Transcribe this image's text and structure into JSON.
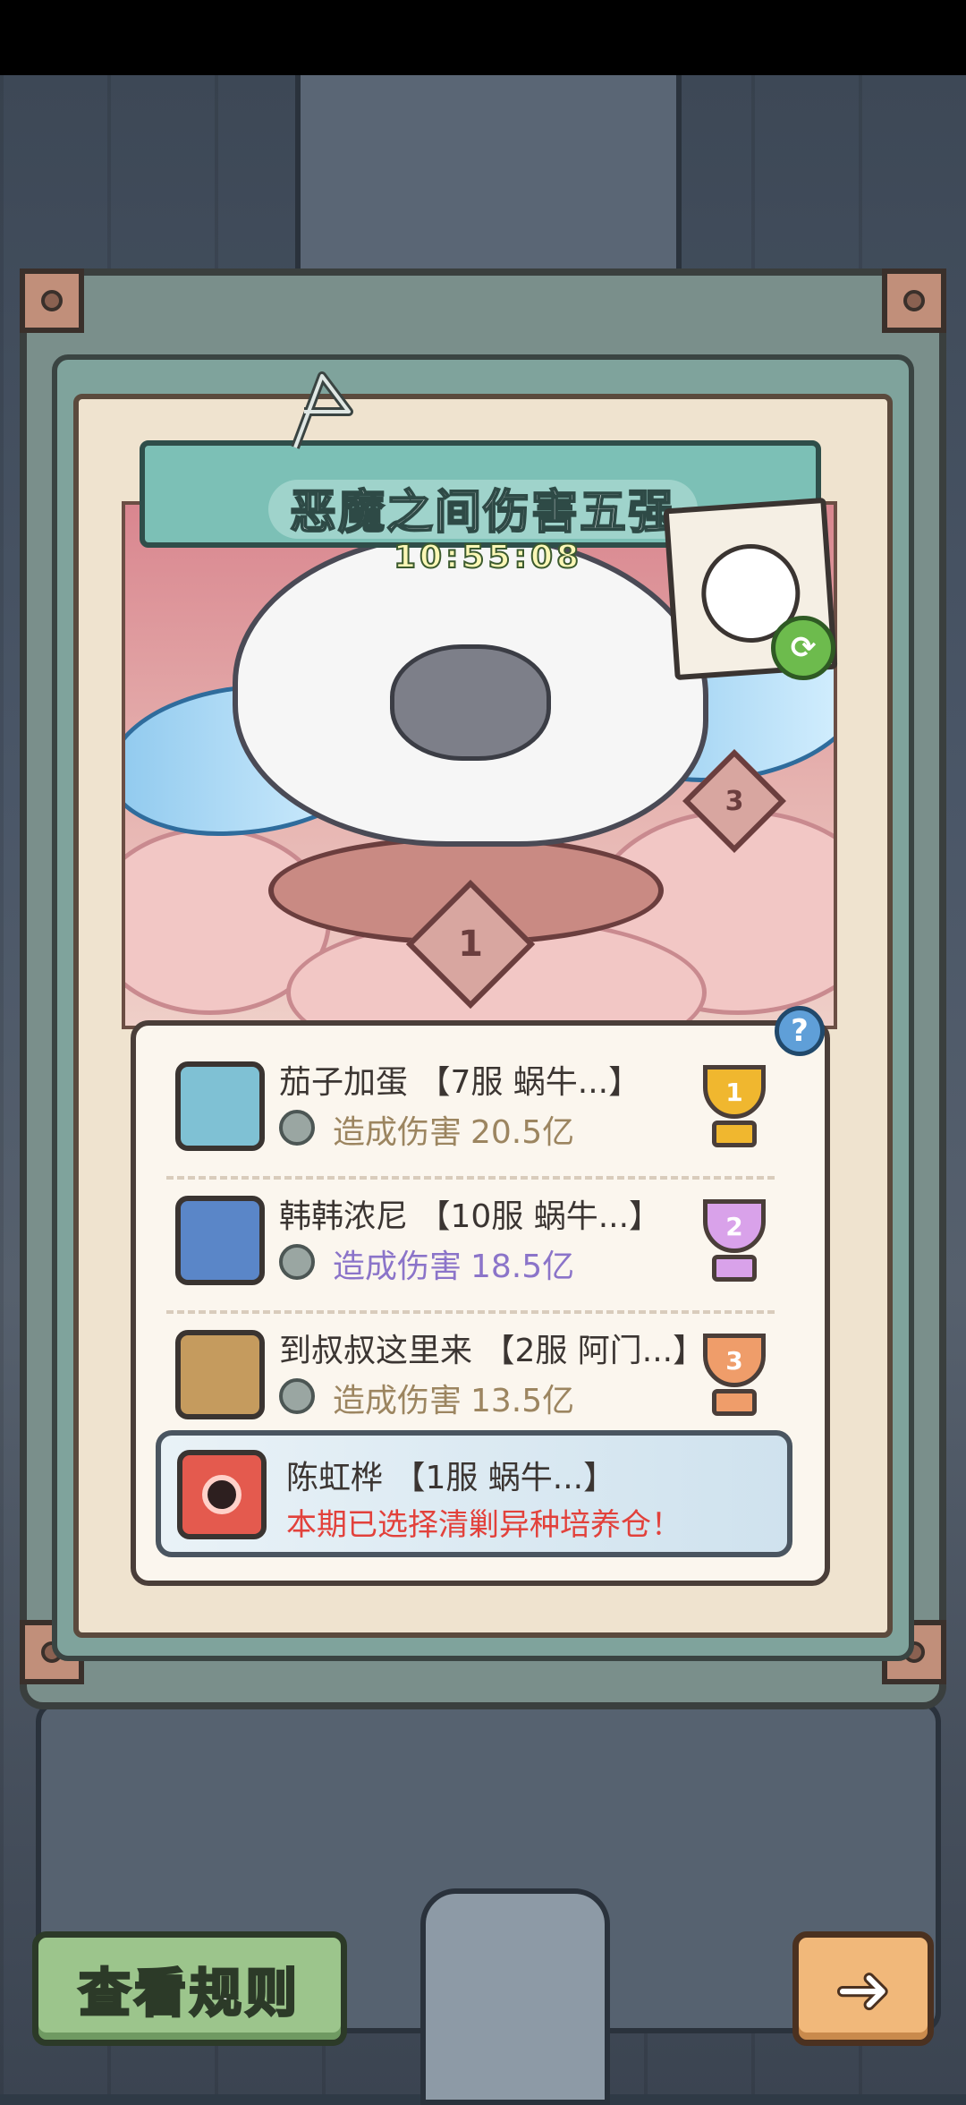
{
  "event": {
    "title": "恶魔之间伤害五强",
    "timer": "10:55:08"
  },
  "art": {
    "rank1_label": "1",
    "rank3_label": "3"
  },
  "ranking": {
    "help_label": "?",
    "rows": [
      {
        "rank": "1",
        "name": "茄子加蛋 【7服 蜗牛...】",
        "damage_label": "造成伤害",
        "damage_value": "20.5亿",
        "trophy_color": "#f0b72f",
        "avatar_color": "#7fc1d4",
        "text_color": "#9c8560"
      },
      {
        "rank": "2",
        "name": "韩韩浓尼 【10服 蜗牛...】",
        "damage_label": "造成伤害",
        "damage_value": "18.5亿",
        "trophy_color": "#d9a2ea",
        "avatar_color": "#5a86c8",
        "text_color": "#8b74c9"
      },
      {
        "rank": "3",
        "name": "到叔叔这里来 【2服 阿门...】",
        "damage_label": "造成伤害",
        "damage_value": "13.5亿",
        "trophy_color": "#ef9d6a",
        "avatar_color": "#c59b5e",
        "text_color": "#9c8560"
      }
    ],
    "self": {
      "name": "陈虹桦 【1服 蜗牛...】",
      "status": "本期已选择清剿异种培养仓！"
    }
  },
  "buttons": {
    "rules_label": "查看规则",
    "next_icon": "arrow-right-icon",
    "refresh_icon": "refresh-icon"
  }
}
